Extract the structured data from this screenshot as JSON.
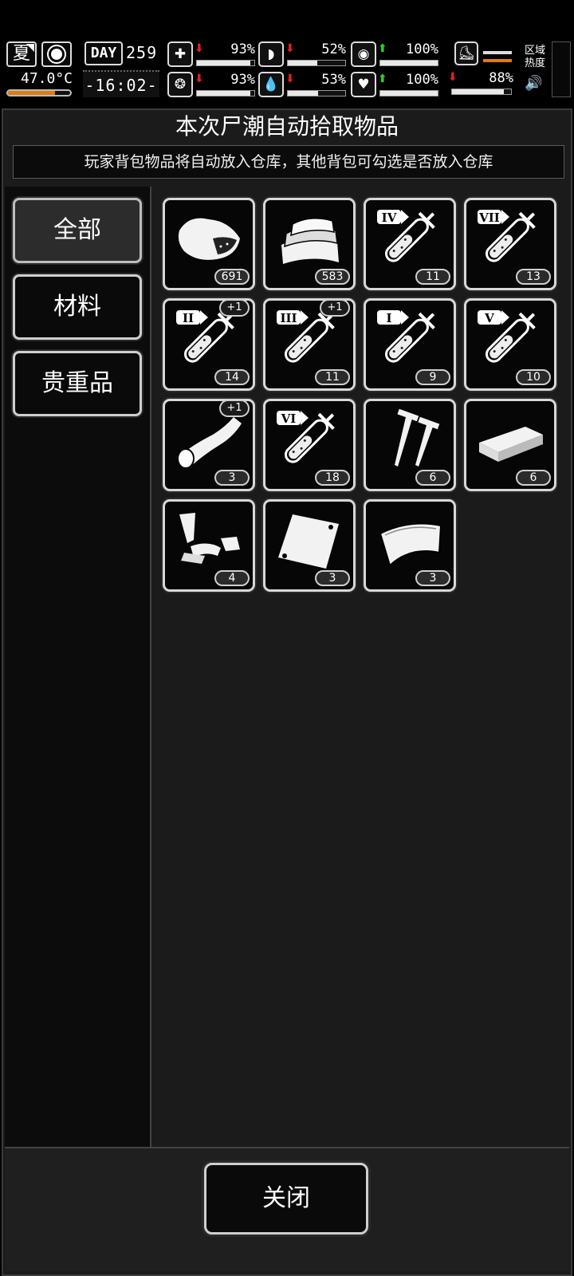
{
  "hud": {
    "season": "夏",
    "temperature": "47.0°C",
    "temperature_level": 0.75,
    "day_label": "DAY",
    "day_number": "259",
    "time": "-16:02-",
    "stats": [
      {
        "name": "health",
        "icon": "medkit-icon",
        "trend": "down",
        "value": "93%",
        "level": 0.93
      },
      {
        "name": "hunger",
        "icon": "stomach-icon",
        "trend": "down",
        "value": "52%",
        "level": 0.52
      },
      {
        "name": "sanity",
        "icon": "head-icon",
        "trend": "up",
        "value": "100%",
        "level": 1.0
      },
      {
        "name": "mood",
        "icon": "brain-icon",
        "trend": "down",
        "value": "93%",
        "level": 0.93
      },
      {
        "name": "thirst",
        "icon": "water-drop-icon",
        "trend": "down",
        "value": "53%",
        "level": 0.53
      },
      {
        "name": "heart",
        "icon": "heart-icon",
        "trend": "up",
        "value": "100%",
        "level": 1.0
      }
    ],
    "stamina": {
      "icon": "boot-icon",
      "trend": "down",
      "value": "88%",
      "level": 0.88
    },
    "area_heat_label_1": "区域",
    "area_heat_label_2": "热度",
    "colors": {
      "accent_orange": "#e07b14",
      "trend_down": "#e02020",
      "trend_up": "#28d228"
    }
  },
  "panel": {
    "title": "本次尸潮自动拾取物品",
    "notice": "玩家背包物品将自动放入仓库，其他背包可勾选是否放入仓库"
  },
  "tabs": [
    {
      "label": "全部",
      "active": true
    },
    {
      "label": "材料",
      "active": false
    },
    {
      "label": "贵重品",
      "active": false
    }
  ],
  "items": [
    {
      "icon": "meat-icon",
      "count": "691",
      "badge": ""
    },
    {
      "icon": "cloth-icon",
      "count": "583",
      "badge": ""
    },
    {
      "icon": "syringe-iv-icon",
      "count": "11",
      "badge": "",
      "numeral": "IV"
    },
    {
      "icon": "syringe-vii-icon",
      "count": "13",
      "badge": "",
      "numeral": "VII"
    },
    {
      "icon": "syringe-ii-icon",
      "count": "14",
      "badge": "+1",
      "numeral": "II"
    },
    {
      "icon": "syringe-iii-icon",
      "count": "11",
      "badge": "+1",
      "numeral": "III"
    },
    {
      "icon": "syringe-i-icon",
      "count": "9",
      "badge": "",
      "numeral": "I"
    },
    {
      "icon": "syringe-v-icon",
      "count": "10",
      "badge": "",
      "numeral": "V"
    },
    {
      "icon": "bone-icon",
      "count": "3",
      "badge": "+1"
    },
    {
      "icon": "syringe-vi-icon",
      "count": "18",
      "badge": "",
      "numeral": "VI"
    },
    {
      "icon": "screws-icon",
      "count": "6",
      "badge": ""
    },
    {
      "icon": "wood-plank-icon",
      "count": "6",
      "badge": ""
    },
    {
      "icon": "scrap-parts-icon",
      "count": "4",
      "badge": ""
    },
    {
      "icon": "metal-sheet-icon",
      "count": "3",
      "badge": ""
    },
    {
      "icon": "leather-icon",
      "count": "3",
      "badge": ""
    }
  ],
  "close_label": "关闭"
}
